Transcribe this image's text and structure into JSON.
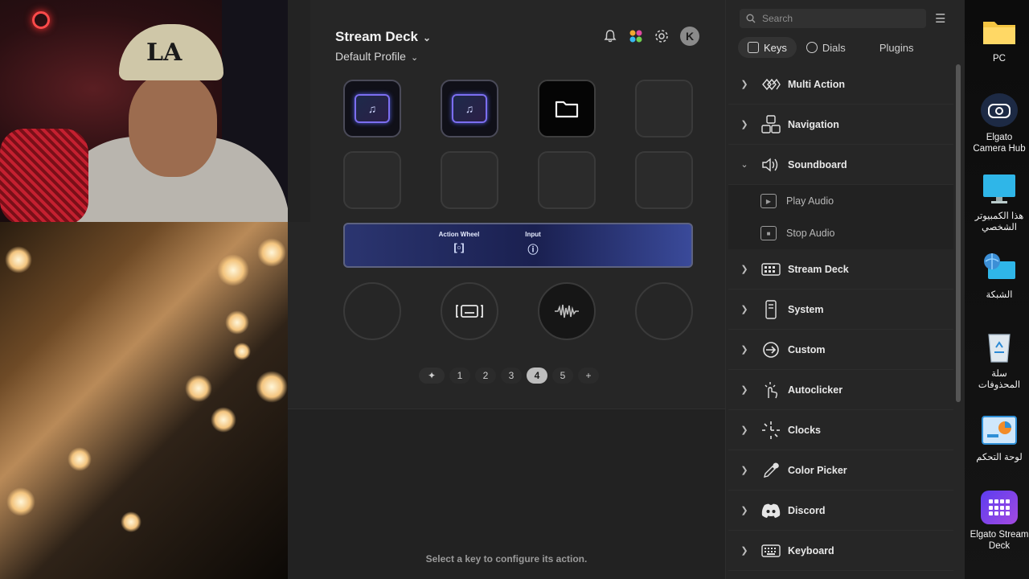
{
  "app": {
    "title": "Stream Deck",
    "profile": "Default Profile",
    "avatar_letter": "K",
    "header_icons": [
      "bell-icon",
      "marketplace-icon",
      "gear-icon"
    ]
  },
  "canvas": {
    "touch_strip": {
      "segments": [
        {
          "label": "Action Wheel",
          "icon": "action-wheel-icon"
        },
        {
          "label": "Input",
          "icon": "headset-icon"
        }
      ]
    },
    "pages": [
      "1",
      "2",
      "3",
      "4",
      "5"
    ],
    "active_page": "4",
    "add_page": "+"
  },
  "config": {
    "message": "Select a key to configure its action."
  },
  "panel": {
    "search_placeholder": "Search",
    "tabs": [
      {
        "label": "Keys"
      },
      {
        "label": "Dials"
      },
      {
        "label": "Plugins"
      }
    ],
    "categories": [
      {
        "label": "Multi Action",
        "icon": "multi-action-icon",
        "expanded": false
      },
      {
        "label": "Navigation",
        "icon": "navigation-icon",
        "expanded": false
      },
      {
        "label": "Soundboard",
        "icon": "speaker-icon",
        "expanded": true,
        "children": [
          {
            "label": "Play Audio",
            "icon": "play-audio-icon"
          },
          {
            "label": "Stop Audio",
            "icon": "stop-audio-icon"
          }
        ]
      },
      {
        "label": "Stream Deck",
        "icon": "stream-deck-icon",
        "expanded": false
      },
      {
        "label": "System",
        "icon": "system-icon",
        "expanded": false
      },
      {
        "label": "Custom",
        "icon": "custom-icon",
        "expanded": false
      },
      {
        "label": "Autoclicker",
        "icon": "autoclicker-icon",
        "expanded": false
      },
      {
        "label": "Clocks",
        "icon": "clocks-icon",
        "expanded": false
      },
      {
        "label": "Color Picker",
        "icon": "color-picker-icon",
        "expanded": false
      },
      {
        "label": "Discord",
        "icon": "discord-icon",
        "expanded": false
      },
      {
        "label": "Keyboard",
        "icon": "keyboard-icon",
        "expanded": false
      }
    ]
  },
  "desktop": {
    "icons": [
      {
        "label": "PC",
        "icon": "folder-icon"
      },
      {
        "label": "Elgato Camera Hub",
        "icon": "camera-hub-icon"
      },
      {
        "label": "هذا الكمبيوتر الشخصي",
        "icon": "monitor-icon"
      },
      {
        "label": "الشبكة",
        "icon": "network-icon"
      },
      {
        "label": "سلة المحذوفات",
        "icon": "recycle-bin-icon"
      },
      {
        "label": "لوحة التحكم",
        "icon": "control-panel-icon"
      },
      {
        "label": "Elgato Stream Deck",
        "icon": "stream-deck-app-icon"
      }
    ]
  },
  "colors": {
    "panel_bg": "#262626",
    "touch_strip": "#2b3570",
    "accent_purple": "#7c6ef0",
    "active_page": "#bdbdbd"
  }
}
